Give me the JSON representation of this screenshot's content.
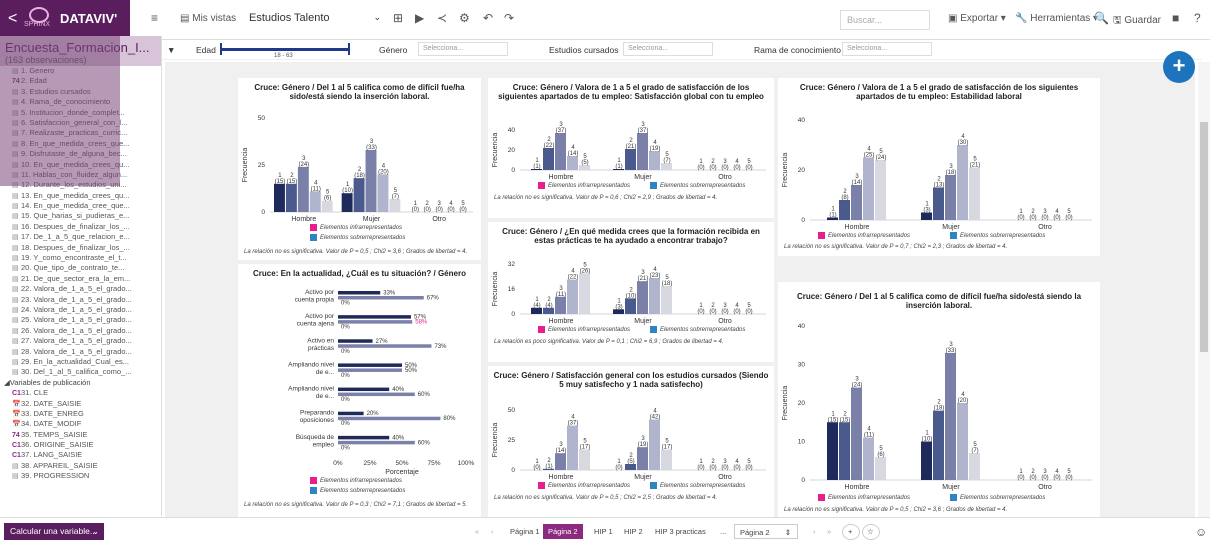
{
  "app": {
    "back": "<",
    "logo": "SPHINX",
    "name": "DATAVIV'"
  },
  "toolbar": {
    "menu": "≡",
    "views": "Mis vistas",
    "study": "Estudios Talento",
    "search_placeholder": "Buscar...",
    "export": "Exportar ▾",
    "tools": "Herramientas ▾",
    "save": "Guardar"
  },
  "sidebar": {
    "title": "Encuesta_Formacion_I...",
    "count": "(163 observaciones)",
    "items": [
      {
        "icon": "▤",
        "label": "1. Genero",
        "t": "c"
      },
      {
        "icon": "74",
        "label": "2. Edad",
        "t": "n"
      },
      {
        "icon": "▤",
        "label": "3. Estudios cursados",
        "t": "c"
      },
      {
        "icon": "▤",
        "label": "4. Rama_de_conocimiento",
        "t": "c"
      },
      {
        "icon": "▤",
        "label": "5. Institucion_donde_complet...",
        "t": "c"
      },
      {
        "icon": "▤",
        "label": "6. Satisfaccion_general_con_l...",
        "t": "c"
      },
      {
        "icon": "▤",
        "label": "7. Realizaste_practicas_curric...",
        "t": "c"
      },
      {
        "icon": "▤",
        "label": "8. En_que_medida_crees_que...",
        "t": "c"
      },
      {
        "icon": "▤",
        "label": "9. Disfrutaste_de_alguna_bec...",
        "t": "c"
      },
      {
        "icon": "▤",
        "label": "10. En_que_medida_crees_qu...",
        "t": "c"
      },
      {
        "icon": "▤",
        "label": "11. Hablas_con_fluidez_algun...",
        "t": "c"
      },
      {
        "icon": "▤",
        "label": "12. Durante_los_estudios_uni...",
        "t": "c"
      },
      {
        "icon": "▤",
        "label": "13. En_que_medida_crees_qu...",
        "t": "c"
      },
      {
        "icon": "▤",
        "label": "14. En_que_medida_cree_que...",
        "t": "c"
      },
      {
        "icon": "▤",
        "label": "15. Que_harias_si_pudieras_e...",
        "t": "c"
      },
      {
        "icon": "▤",
        "label": "16. Despues_de_finalizar_los_...",
        "t": "c"
      },
      {
        "icon": "▤",
        "label": "17. De_1_a_5_que_relacion_e...",
        "t": "c"
      },
      {
        "icon": "▤",
        "label": "18. Despues_de_finalizar_los_...",
        "t": "c"
      },
      {
        "icon": "▤",
        "label": "19. Y_como_encontraste_el_t...",
        "t": "c"
      },
      {
        "icon": "▤",
        "label": "20. Que_tipo_de_contrato_te...",
        "t": "c"
      },
      {
        "icon": "▤",
        "label": "21. De_que_sector_era_la_em...",
        "t": "c"
      },
      {
        "icon": "▤",
        "label": "22. Valora_de_1_a_5_el_grado...",
        "t": "c"
      },
      {
        "icon": "▤",
        "label": "23. Valora_de_1_a_5_el_grado...",
        "t": "c"
      },
      {
        "icon": "▤",
        "label": "24. Valora_de_1_a_5_el_grado...",
        "t": "c"
      },
      {
        "icon": "▤",
        "label": "25. Valora_de_1_a_5_el_grado...",
        "t": "c"
      },
      {
        "icon": "▤",
        "label": "26. Valora_de_1_a_5_el_grado...",
        "t": "c"
      },
      {
        "icon": "▤",
        "label": "27. Valora_de_1_a_5_el_grado...",
        "t": "c"
      },
      {
        "icon": "▤",
        "label": "28. Valora_de_1_a_5_el_grado...",
        "t": "c"
      },
      {
        "icon": "▤",
        "label": "29. En_la_actualidad_Cual_es...",
        "t": "c"
      },
      {
        "icon": "▤",
        "label": "30. Del_1_al_5_califica_como_...",
        "t": "c"
      },
      {
        "icon": "◢",
        "label": "Variables de publicación",
        "t": "g"
      },
      {
        "icon": "C1",
        "label": "31. CLE",
        "t": "n"
      },
      {
        "icon": "📅",
        "label": "32. DATE_SAISIE",
        "t": "c"
      },
      {
        "icon": "📅",
        "label": "33. DATE_ENREG",
        "t": "c"
      },
      {
        "icon": "📅",
        "label": "34. DATE_MODIF",
        "t": "c"
      },
      {
        "icon": "74",
        "label": "35. TEMPS_SAISIE",
        "t": "n"
      },
      {
        "icon": "C1",
        "label": "36. ORIGINE_SAISIE",
        "t": "n"
      },
      {
        "icon": "C1",
        "label": "37. LANG_SAISIE",
        "t": "n"
      },
      {
        "icon": "▤",
        "label": "38. APPAREIL_SAISIE",
        "t": "c"
      },
      {
        "icon": "▤",
        "label": "39. PROGRESSION",
        "t": "c"
      }
    ]
  },
  "filters": {
    "edad_label": "Edad",
    "edad_range": "18 - 63",
    "genero_label": "Género",
    "genero_ph": "Selecciona...",
    "estudios_label": "Estudios cursados",
    "estudios_ph": "Selecciona...",
    "rama_label": "Rama de conocimiento",
    "rama_ph": "Selecciona..."
  },
  "legend": {
    "infra": "Elementos infrarrepresentados",
    "sobre": "Elementos sobrerrepresentados",
    "infra_color": "#e91e8c",
    "sobre_color": "#2e86c1"
  },
  "colors": [
    "#1f2a5c",
    "#4a5a8c",
    "#7a80a8",
    "#b0b4cc",
    "#d8d8e0"
  ],
  "panels": {
    "p1": {
      "title": "Cruce: Género / Del 1 al 5 califica como de difícil fue/ha sido/está siendo la inserción laboral.",
      "note": "La relación no es significativa. Valor de P = 0,5 ; Chi2 = 3,6 ; Grados de libertad = 4."
    },
    "p2": {
      "title": "Cruce: En la actualidad, ¿Cuál es tu situación? / Género",
      "note": "La relación no es significativa. Valor de P = 0,3 ; Chi2 = 7,1 ; Grados de libertad = 5."
    },
    "p3": {
      "title": "Cruce: Género / Valora de 1 a 5 el grado de satisfacción de los siguientes apartados de tu empleo: Satisfacción global con tu empleo",
      "note": "La relación no es significativa. Valor de P = 0,6 ; Chi2 = 2,9 ; Grados de libertad = 4."
    },
    "p4": {
      "title": "Cruce: Género / ¿En qué medida crees que la formación recibida en estas prácticas te ha ayudado a encontrar trabajo?",
      "note": "La relación es poco significativa. Valor de P = 0,1 ; Chi2 = 6,9 ; Grados de libertad = 4."
    },
    "p5": {
      "title": "Cruce: Género / Satisfacción general con los estudios cursados (Siendo 5 muy satisfecho y 1 nada satisfecho)",
      "note": "La relación no es significativa. Valor de P = 0,5 ; Chi2 = 2,5 ; Grados de libertad = 4."
    },
    "p6": {
      "title": "Cruce: Género / Valora de 1 a 5 el grado de satisfacción de los siguientes apartados de tu empleo: Estabilidad laboral",
      "note": "La relación no es significativa. Valor de P = 0,7 ; Chi2 = 2,3 ; Grados de libertad = 4."
    },
    "p7": {
      "title": "Cruce: Género / Del 1 al 5 califica como de difícil fue/ha sido/está siendo la inserción laboral.",
      "note": "La relación no es significativa. Valor de P = 0,5 ; Chi2 = 3,6 ; Grados de libertad = 4."
    }
  },
  "chart_data": [
    {
      "id": "p1",
      "type": "bar",
      "ylabel": "Frecuencia",
      "categories": [
        "Hombre",
        "Mujer",
        "Otro"
      ],
      "ylim": [
        0,
        50
      ],
      "yticks": [
        0,
        25,
        50
      ],
      "series": [
        {
          "name": "1",
          "values": [
            15,
            10,
            0
          ],
          "labels": [
            "(15)",
            "(10)",
            "(0)"
          ]
        },
        {
          "name": "2",
          "values": [
            15,
            18,
            0
          ],
          "labels": [
            "(15)",
            "(18)",
            "(0)"
          ]
        },
        {
          "name": "3",
          "values": [
            24,
            33,
            0
          ],
          "labels": [
            "(24)",
            "(33)",
            "(0)"
          ]
        },
        {
          "name": "4",
          "values": [
            11,
            20,
            0
          ],
          "labels": [
            "(11)",
            "(20)",
            "(0)"
          ]
        },
        {
          "name": "5",
          "values": [
            6,
            7,
            0
          ],
          "labels": [
            "(6)",
            "(7)",
            "(0)"
          ]
        }
      ]
    },
    {
      "id": "p3",
      "type": "bar",
      "ylabel": "Frecuencia",
      "categories": [
        "Hombre",
        "Mujer",
        "Otro"
      ],
      "ylim": [
        0,
        40
      ],
      "yticks": [
        0,
        20,
        40
      ],
      "series": [
        {
          "name": "1",
          "values": [
            1,
            1,
            0
          ],
          "labels": [
            "(1)",
            "(1)",
            "(0)"
          ]
        },
        {
          "name": "2",
          "values": [
            22,
            21,
            0
          ],
          "labels": [
            "(22)",
            "(21)",
            "(0)"
          ]
        },
        {
          "name": "3",
          "values": [
            37,
            37,
            0
          ],
          "labels": [
            "(37)",
            "(37)",
            "(0)"
          ]
        },
        {
          "name": "4",
          "values": [
            14,
            19,
            0
          ],
          "labels": [
            "(14)",
            "(19)",
            "(0)"
          ]
        },
        {
          "name": "5",
          "values": [
            5,
            7,
            0
          ],
          "labels": [
            "(5)",
            "(7)",
            "(0)"
          ]
        }
      ]
    },
    {
      "id": "p4",
      "type": "bar",
      "ylabel": "Frecuencia",
      "categories": [
        "Hombre",
        "Mujer",
        "Otro"
      ],
      "ylim": [
        0,
        32
      ],
      "yticks": [
        0,
        16,
        32
      ],
      "series": [
        {
          "name": "1",
          "values": [
            4,
            3,
            0
          ],
          "labels": [
            "(4)",
            "(3)",
            "(0)"
          ]
        },
        {
          "name": "2",
          "values": [
            4,
            10,
            0
          ],
          "labels": [
            "(4)",
            "(10)",
            "(0)"
          ]
        },
        {
          "name": "3",
          "values": [
            11,
            21,
            0
          ],
          "labels": [
            "(11)",
            "(21)",
            "(0)"
          ]
        },
        {
          "name": "4",
          "values": [
            22,
            23,
            0
          ],
          "labels": [
            "(22)",
            "(23)",
            "(0)"
          ]
        },
        {
          "name": "5",
          "values": [
            26,
            18,
            0
          ],
          "labels": [
            "(26)",
            "(18)",
            "(0)"
          ]
        }
      ]
    },
    {
      "id": "p5",
      "type": "bar",
      "ylabel": "Frecuencia",
      "categories": [
        "Hombre",
        "Mujer",
        "Otro"
      ],
      "ylim": [
        0,
        50
      ],
      "yticks": [
        0,
        25,
        50
      ],
      "series": [
        {
          "name": "1",
          "values": [
            0,
            0,
            0
          ],
          "labels": [
            "(0)",
            "(0)",
            "(0)"
          ]
        },
        {
          "name": "2",
          "values": [
            1,
            5,
            0
          ],
          "labels": [
            "(1)",
            "(5)",
            "(0)"
          ]
        },
        {
          "name": "3",
          "values": [
            14,
            19,
            0
          ],
          "labels": [
            "(14)",
            "(19)",
            "(0)"
          ]
        },
        {
          "name": "4",
          "values": [
            37,
            42,
            0
          ],
          "labels": [
            "(37)",
            "(42)",
            "(0)"
          ]
        },
        {
          "name": "5",
          "values": [
            17,
            17,
            0
          ],
          "labels": [
            "(17)",
            "(17)",
            "(0)"
          ]
        }
      ]
    },
    {
      "id": "p6",
      "type": "bar",
      "ylabel": "Frecuencia",
      "categories": [
        "Hombre",
        "Mujer",
        "Otro"
      ],
      "ylim": [
        0,
        40
      ],
      "yticks": [
        0,
        20,
        40
      ],
      "series": [
        {
          "name": "1",
          "values": [
            1,
            3,
            0
          ],
          "labels": [
            "(1)",
            "(3)",
            "(0)"
          ]
        },
        {
          "name": "2",
          "values": [
            8,
            13,
            0
          ],
          "labels": [
            "(8)",
            "(13)",
            "(0)"
          ]
        },
        {
          "name": "3",
          "values": [
            14,
            18,
            0
          ],
          "labels": [
            "(14)",
            "(18)",
            "(0)"
          ]
        },
        {
          "name": "4",
          "values": [
            25,
            30,
            0
          ],
          "labels": [
            "(25)",
            "(30)",
            "(0)"
          ]
        },
        {
          "name": "5",
          "values": [
            24,
            21,
            0
          ],
          "labels": [
            "(24)",
            "(21)",
            "(0)"
          ]
        }
      ]
    },
    {
      "id": "p7",
      "type": "bar",
      "ylabel": "Frecuencia",
      "categories": [
        "Hombre",
        "Mujer",
        "Otro"
      ],
      "ylim": [
        0,
        40
      ],
      "yticks": [
        0,
        10,
        20,
        30,
        40
      ],
      "series": [
        {
          "name": "1",
          "values": [
            15,
            10,
            0
          ],
          "labels": [
            "(15)",
            "(10)",
            "(0)"
          ]
        },
        {
          "name": "2",
          "values": [
            15,
            18,
            0
          ],
          "labels": [
            "(15)",
            "(18)",
            "(0)"
          ]
        },
        {
          "name": "3",
          "values": [
            24,
            33,
            0
          ],
          "labels": [
            "(24)",
            "(33)",
            "(0)"
          ]
        },
        {
          "name": "4",
          "values": [
            11,
            20,
            0
          ],
          "labels": [
            "(11)",
            "(20)",
            "(0)"
          ]
        },
        {
          "name": "5",
          "values": [
            6,
            7,
            0
          ],
          "labels": [
            "(6)",
            "(7)",
            "(0)"
          ]
        }
      ]
    },
    {
      "id": "p2",
      "type": "hbar",
      "xlabel": "Porcentaje",
      "xlim": [
        0,
        100
      ],
      "xticks": [
        "0%",
        "25%",
        "50%",
        "75%",
        "100%"
      ],
      "categories": [
        "Activo por cuenta propia",
        "Activo por cuenta ajena",
        "Activo en prácticas",
        "Ampliando nivel de e...",
        "Ampliando nivel de e...",
        "Preparando oposiciones",
        "Búsqueda de empleo"
      ],
      "series": [
        {
          "name": "Hombre",
          "values": [
            33,
            57,
            27,
            50,
            40,
            20,
            40
          ],
          "labels": [
            "33%",
            "57%",
            "27%",
            "50%",
            "40%",
            "20%",
            "40%"
          ]
        },
        {
          "name": "Mujer",
          "values": [
            67,
            58,
            73,
            50,
            60,
            80,
            60
          ],
          "labels": [
            "67%",
            "58%",
            "73%",
            "50%",
            "60%",
            "80%",
            "60%"
          ]
        },
        {
          "name": "Otro",
          "values": [
            0,
            0,
            0,
            0,
            0,
            0,
            0
          ],
          "labels": [
            "0%",
            "0%",
            "0%",
            "0%",
            "0%",
            "0%",
            "0%"
          ]
        }
      ]
    }
  ],
  "bottom": {
    "calc": "Calcular una variable...",
    "tabs": [
      "Página 1",
      "Página 2",
      "HIP 1",
      "HIP 2",
      "HIP 3 practicas",
      "...",
      "Página 2"
    ]
  }
}
